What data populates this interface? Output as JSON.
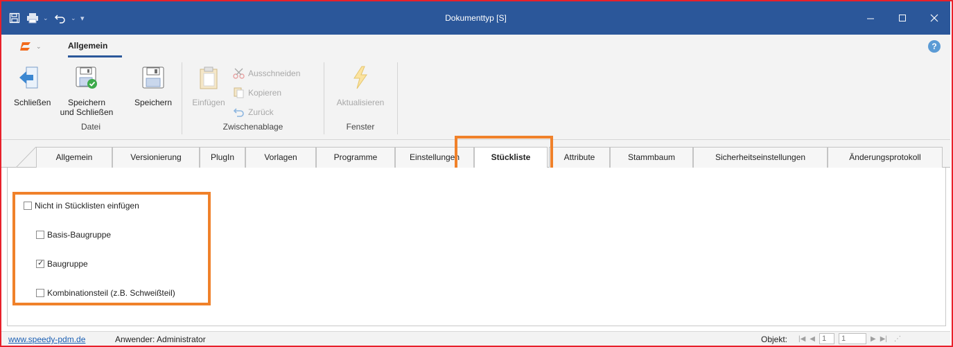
{
  "window": {
    "title": "Dokumenttyp [S]",
    "controls": [
      "minimize",
      "maximize",
      "close"
    ],
    "border_color": "#e8202a",
    "titlebar_color": "#2b579a"
  },
  "quick_access": [
    "save-icon",
    "print-icon",
    "undo-icon",
    "customize-icon"
  ],
  "ribbon": {
    "tab": "Allgemein",
    "groups": {
      "datei": {
        "label": "Datei",
        "buttons": {
          "close": "Schließen",
          "save_close_1": "Speichern",
          "save_close_2": "und Schließen",
          "save": "Speichern"
        }
      },
      "clipboard": {
        "label": "Zwischenablage",
        "paste": "Einfügen",
        "cut": "Ausschneiden",
        "copy": "Kopieren",
        "undo": "Zurück"
      },
      "fenster": {
        "label": "Fenster",
        "refresh": "Aktualisieren"
      }
    }
  },
  "tabs": {
    "items": [
      "Allgemein",
      "Versionierung",
      "PlugIn",
      "Vorlagen",
      "Programme",
      "Einstellungen",
      "Stückliste",
      "Attribute",
      "Stammbaum",
      "Sicherheitseinstellungen",
      "Änderungsprotokoll"
    ],
    "active": "Stückliste"
  },
  "options": {
    "not_in_bom": {
      "label": "Nicht in Stücklisten einfügen",
      "checked": false
    },
    "basis_assembly": {
      "label": "Basis-Baugruppe",
      "checked": false
    },
    "assembly": {
      "label": "Baugruppe",
      "checked": true
    },
    "combination": {
      "label": "Kombinationsteil (z.B. Schweißteil)",
      "checked": false
    }
  },
  "highlight_color": "#f0812a",
  "status": {
    "link": "www.speedy-pdm.de",
    "user": "Anwender: Administrator",
    "object_label": "Objekt:",
    "page": "1",
    "count": "1"
  }
}
